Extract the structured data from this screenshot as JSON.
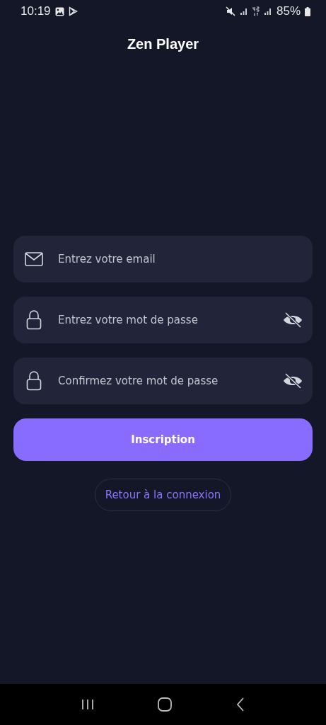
{
  "status_bar": {
    "time": "10:19",
    "battery": "85%"
  },
  "title": "Zen Player",
  "fields": [
    {
      "kind": "email",
      "placeholder": "Entrez votre email"
    },
    {
      "kind": "password",
      "placeholder": "Entrez votre mot de passe",
      "show_password": false
    },
    {
      "kind": "password",
      "placeholder": "Confirmez votre mot de passe",
      "show_password": false
    }
  ],
  "submit_button": "Inscription",
  "back_link": "Retour à la connexion"
}
